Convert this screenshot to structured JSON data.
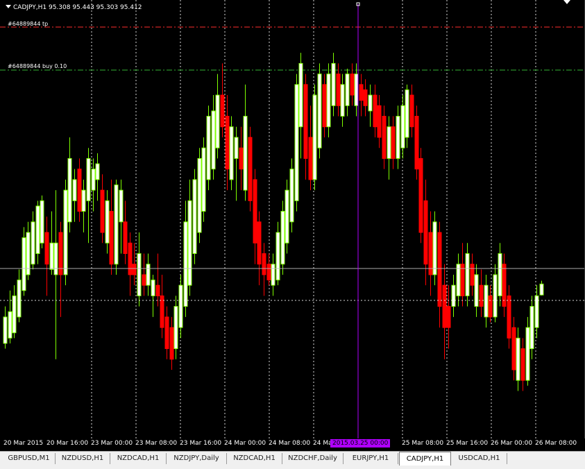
{
  "chart": {
    "title": "CADJPY,H1  95.308 95.443 95.303 95.412",
    "orders": [
      {
        "label": "#64889844 tp",
        "color": "#ff2b2b"
      },
      {
        "label": "#64889844 buy 0.10",
        "color": "#33b233"
      }
    ],
    "time_labels": [
      "20 Mar 2015",
      "20 Mar 16:00",
      "23 Mar 00:00",
      "23 Mar 08:00",
      "23 Mar 16:00",
      "24 Mar 00:00",
      "24 Mar 08:00",
      "24 Mar",
      "25 Mar 08:00",
      "25 Mar 16:00",
      "26 Mar 00:00",
      "26 Mar 08:00"
    ],
    "crosshair_time": "2015.03.25 00:00",
    "colors": {
      "bull_body": "#ffffff",
      "bull_outline": "#7fff00",
      "bear_body": "#ff0000",
      "wick": "#ff0000",
      "background": "#000000",
      "grid": "#ffffff",
      "crosshair": "#b000ff"
    }
  },
  "chart_data": {
    "type": "candlestick",
    "title": "CADJPY,H1",
    "series": [
      {
        "dir": "up",
        "o": 94.85,
        "h": 95.2,
        "l": 94.8,
        "c": 95.1
      },
      {
        "dir": "up",
        "o": 94.9,
        "h": 95.35,
        "l": 94.85,
        "c": 95.15
      },
      {
        "dir": "up",
        "o": 94.95,
        "h": 95.4,
        "l": 94.9,
        "c": 95.3
      },
      {
        "dir": "up",
        "o": 95.1,
        "h": 95.55,
        "l": 95.05,
        "c": 95.45
      },
      {
        "dir": "up",
        "o": 95.35,
        "h": 95.95,
        "l": 95.3,
        "c": 95.85
      },
      {
        "dir": "up",
        "o": 95.5,
        "h": 96.0,
        "l": 95.45,
        "c": 95.9
      },
      {
        "dir": "up",
        "o": 95.6,
        "h": 96.1,
        "l": 95.55,
        "c": 96.0
      },
      {
        "dir": "up",
        "o": 95.7,
        "h": 96.2,
        "l": 95.6,
        "c": 96.15
      },
      {
        "dir": "up",
        "o": 95.8,
        "h": 96.25,
        "l": 95.75,
        "c": 96.2
      },
      {
        "dir": "down",
        "o": 95.9,
        "h": 96.05,
        "l": 95.3,
        "c": 95.6
      },
      {
        "dir": "up",
        "o": 95.55,
        "h": 96.1,
        "l": 95.5,
        "c": 95.8
      },
      {
        "dir": "up",
        "o": 95.5,
        "h": 96.3,
        "l": 94.7,
        "c": 95.8
      },
      {
        "dir": "down",
        "o": 95.9,
        "h": 96.0,
        "l": 95.1,
        "c": 95.5
      },
      {
        "dir": "up",
        "o": 95.5,
        "h": 96.4,
        "l": 95.4,
        "c": 96.3
      },
      {
        "dir": "up",
        "o": 96.0,
        "h": 96.8,
        "l": 95.9,
        "c": 96.6
      },
      {
        "dir": "up",
        "o": 96.2,
        "h": 96.5,
        "l": 96.0,
        "c": 96.4
      },
      {
        "dir": "down",
        "o": 96.5,
        "h": 96.6,
        "l": 96.0,
        "c": 96.1
      },
      {
        "dir": "up",
        "o": 96.1,
        "h": 96.4,
        "l": 95.9,
        "c": 96.3
      },
      {
        "dir": "up",
        "o": 96.2,
        "h": 96.7,
        "l": 95.8,
        "c": 96.6
      },
      {
        "dir": "up",
        "o": 96.3,
        "h": 96.6,
        "l": 96.1,
        "c": 96.5
      },
      {
        "dir": "up",
        "o": 96.4,
        "h": 96.65,
        "l": 96.2,
        "c": 96.55
      },
      {
        "dir": "down",
        "o": 96.3,
        "h": 96.45,
        "l": 95.8,
        "c": 95.9
      },
      {
        "dir": "up",
        "o": 95.8,
        "h": 96.3,
        "l": 95.7,
        "c": 96.2
      },
      {
        "dir": "down",
        "o": 96.1,
        "h": 96.4,
        "l": 95.5,
        "c": 95.6
      },
      {
        "dir": "up",
        "o": 95.6,
        "h": 96.4,
        "l": 95.5,
        "c": 96.35
      },
      {
        "dir": "up",
        "o": 96.0,
        "h": 96.4,
        "l": 95.7,
        "c": 96.3
      },
      {
        "dir": "down",
        "o": 96.0,
        "h": 96.2,
        "l": 95.6,
        "c": 95.7
      },
      {
        "dir": "down",
        "o": 95.8,
        "h": 95.9,
        "l": 95.3,
        "c": 95.5
      },
      {
        "dir": "down",
        "o": 95.6,
        "h": 95.8,
        "l": 95.4,
        "c": 95.5
      },
      {
        "dir": "up",
        "o": 95.3,
        "h": 95.9,
        "l": 95.2,
        "c": 95.7
      },
      {
        "dir": "down",
        "o": 95.5,
        "h": 95.7,
        "l": 95.3,
        "c": 95.4
      },
      {
        "dir": "up",
        "o": 95.4,
        "h": 95.7,
        "l": 95.3,
        "c": 95.6
      },
      {
        "dir": "up",
        "o": 95.3,
        "h": 95.5,
        "l": 95.1,
        "c": 95.45
      },
      {
        "dir": "down",
        "o": 95.4,
        "h": 95.7,
        "l": 95.2,
        "c": 95.3
      },
      {
        "dir": "down",
        "o": 95.3,
        "h": 95.5,
        "l": 94.9,
        "c": 95.0
      },
      {
        "dir": "down",
        "o": 95.1,
        "h": 95.2,
        "l": 94.7,
        "c": 94.8
      },
      {
        "dir": "down",
        "o": 95.0,
        "h": 95.1,
        "l": 94.6,
        "c": 94.7
      },
      {
        "dir": "up",
        "o": 94.8,
        "h": 95.3,
        "l": 94.7,
        "c": 95.2
      },
      {
        "dir": "up",
        "o": 95.0,
        "h": 95.5,
        "l": 94.9,
        "c": 95.4
      },
      {
        "dir": "up",
        "o": 95.2,
        "h": 96.2,
        "l": 95.1,
        "c": 96.0
      },
      {
        "dir": "up",
        "o": 95.4,
        "h": 96.4,
        "l": 95.3,
        "c": 96.2
      },
      {
        "dir": "up",
        "o": 95.7,
        "h": 96.5,
        "l": 95.6,
        "c": 96.4
      },
      {
        "dir": "up",
        "o": 95.9,
        "h": 96.7,
        "l": 95.8,
        "c": 96.6
      },
      {
        "dir": "up",
        "o": 96.1,
        "h": 96.8,
        "l": 96.0,
        "c": 96.7
      },
      {
        "dir": "up",
        "o": 96.4,
        "h": 97.1,
        "l": 96.3,
        "c": 97.0
      },
      {
        "dir": "up",
        "o": 96.5,
        "h": 97.2,
        "l": 96.4,
        "c": 97.05
      },
      {
        "dir": "up",
        "o": 96.7,
        "h": 97.4,
        "l": 96.6,
        "c": 97.2
      },
      {
        "dir": "down",
        "o": 97.2,
        "h": 97.5,
        "l": 96.8,
        "c": 96.9
      },
      {
        "dir": "down",
        "o": 97.0,
        "h": 97.2,
        "l": 96.3,
        "c": 96.5
      },
      {
        "dir": "up",
        "o": 96.4,
        "h": 97.0,
        "l": 96.3,
        "c": 96.9
      },
      {
        "dir": "up",
        "o": 96.6,
        "h": 96.9,
        "l": 96.2,
        "c": 96.8
      },
      {
        "dir": "down",
        "o": 96.7,
        "h": 96.9,
        "l": 96.3,
        "c": 96.5
      },
      {
        "dir": "up",
        "o": 96.3,
        "h": 97.3,
        "l": 96.2,
        "c": 97.0
      },
      {
        "dir": "down",
        "o": 96.8,
        "h": 96.9,
        "l": 96.1,
        "c": 96.2
      },
      {
        "dir": "down",
        "o": 96.4,
        "h": 96.5,
        "l": 95.6,
        "c": 95.8
      },
      {
        "dir": "down",
        "o": 96.0,
        "h": 96.1,
        "l": 95.4,
        "c": 95.6
      },
      {
        "dir": "down",
        "o": 95.7,
        "h": 95.8,
        "l": 95.3,
        "c": 95.5
      },
      {
        "dir": "down",
        "o": 95.6,
        "h": 95.7,
        "l": 95.4,
        "c": 95.45
      },
      {
        "dir": "up",
        "o": 95.4,
        "h": 95.7,
        "l": 95.3,
        "c": 95.6
      },
      {
        "dir": "up",
        "o": 95.45,
        "h": 96.0,
        "l": 95.4,
        "c": 95.9
      },
      {
        "dir": "up",
        "o": 95.6,
        "h": 96.2,
        "l": 95.5,
        "c": 96.1
      },
      {
        "dir": "up",
        "o": 95.8,
        "h": 96.4,
        "l": 95.7,
        "c": 96.3
      },
      {
        "dir": "up",
        "o": 96.0,
        "h": 96.6,
        "l": 95.9,
        "c": 96.5
      },
      {
        "dir": "up",
        "o": 96.2,
        "h": 97.4,
        "l": 96.1,
        "c": 97.3
      },
      {
        "dir": "up",
        "o": 96.9,
        "h": 97.6,
        "l": 96.6,
        "c": 97.5
      },
      {
        "dir": "down",
        "o": 97.3,
        "h": 97.4,
        "l": 96.4,
        "c": 96.6
      },
      {
        "dir": "down",
        "o": 96.8,
        "h": 97.1,
        "l": 96.3,
        "c": 96.4
      },
      {
        "dir": "up",
        "o": 96.4,
        "h": 97.3,
        "l": 96.3,
        "c": 97.2
      },
      {
        "dir": "up",
        "o": 96.7,
        "h": 97.5,
        "l": 96.6,
        "c": 97.4
      },
      {
        "dir": "down",
        "o": 97.3,
        "h": 97.4,
        "l": 96.8,
        "c": 96.9
      },
      {
        "dir": "up",
        "o": 96.9,
        "h": 97.5,
        "l": 96.8,
        "c": 97.4
      },
      {
        "dir": "up",
        "o": 97.1,
        "h": 97.6,
        "l": 97.0,
        "c": 97.5
      },
      {
        "dir": "down",
        "o": 97.4,
        "h": 97.5,
        "l": 97.0,
        "c": 97.1
      },
      {
        "dir": "up",
        "o": 97.0,
        "h": 97.4,
        "l": 96.9,
        "c": 97.3
      },
      {
        "dir": "up",
        "o": 97.1,
        "h": 97.45,
        "l": 97.0,
        "c": 97.4
      },
      {
        "dir": "down",
        "o": 97.4,
        "h": 97.5,
        "l": 97.1,
        "c": 97.2
      },
      {
        "dir": "up",
        "o": 97.1,
        "h": 97.5,
        "l": 97.0,
        "c": 97.4
      },
      {
        "dir": "down",
        "o": 97.3,
        "h": 97.4,
        "l": 97.0,
        "c": 97.15
      },
      {
        "dir": "down",
        "o": 97.25,
        "h": 97.35,
        "l": 97.0,
        "c": 97.1
      },
      {
        "dir": "up",
        "o": 97.05,
        "h": 97.3,
        "l": 96.9,
        "c": 97.2
      },
      {
        "dir": "down",
        "o": 97.2,
        "h": 97.3,
        "l": 96.8,
        "c": 96.9
      },
      {
        "dir": "down",
        "o": 97.1,
        "h": 97.2,
        "l": 96.7,
        "c": 96.8
      },
      {
        "dir": "down",
        "o": 97.0,
        "h": 97.1,
        "l": 96.5,
        "c": 96.6
      },
      {
        "dir": "up",
        "o": 96.6,
        "h": 97.0,
        "l": 96.4,
        "c": 96.9
      },
      {
        "dir": "down",
        "o": 96.9,
        "h": 97.0,
        "l": 96.5,
        "c": 96.6
      },
      {
        "dir": "up",
        "o": 96.6,
        "h": 97.1,
        "l": 96.5,
        "c": 97.0
      },
      {
        "dir": "up",
        "o": 96.7,
        "h": 97.2,
        "l": 96.6,
        "c": 97.1
      },
      {
        "dir": "up",
        "o": 96.8,
        "h": 97.3,
        "l": 96.7,
        "c": 97.25
      },
      {
        "dir": "down",
        "o": 97.2,
        "h": 97.3,
        "l": 96.8,
        "c": 96.9
      },
      {
        "dir": "down",
        "o": 97.0,
        "h": 97.1,
        "l": 96.4,
        "c": 96.5
      },
      {
        "dir": "down",
        "o": 96.6,
        "h": 96.7,
        "l": 95.8,
        "c": 95.9
      },
      {
        "dir": "down",
        "o": 96.2,
        "h": 96.4,
        "l": 95.4,
        "c": 95.6
      },
      {
        "dir": "down",
        "o": 95.9,
        "h": 96.1,
        "l": 95.3,
        "c": 95.5
      },
      {
        "dir": "up",
        "o": 95.5,
        "h": 96.1,
        "l": 95.4,
        "c": 96.0
      },
      {
        "dir": "down",
        "o": 95.9,
        "h": 96.0,
        "l": 95.0,
        "c": 95.2
      },
      {
        "dir": "down",
        "o": 95.4,
        "h": 95.6,
        "l": 94.7,
        "c": 95.0
      },
      {
        "dir": "down",
        "o": 95.2,
        "h": 95.4,
        "l": 94.8,
        "c": 95.0
      },
      {
        "dir": "up",
        "o": 95.2,
        "h": 95.5,
        "l": 95.1,
        "c": 95.4
      },
      {
        "dir": "up",
        "o": 95.3,
        "h": 95.7,
        "l": 95.2,
        "c": 95.6
      },
      {
        "dir": "down",
        "o": 95.6,
        "h": 95.8,
        "l": 95.2,
        "c": 95.3
      },
      {
        "dir": "up",
        "o": 95.3,
        "h": 95.8,
        "l": 95.2,
        "c": 95.7
      },
      {
        "dir": "down",
        "o": 95.6,
        "h": 95.7,
        "l": 95.3,
        "c": 95.4
      },
      {
        "dir": "up",
        "o": 95.2,
        "h": 95.6,
        "l": 95.1,
        "c": 95.5
      },
      {
        "dir": "down",
        "o": 95.4,
        "h": 95.55,
        "l": 95.1,
        "c": 95.2
      },
      {
        "dir": "up",
        "o": 95.1,
        "h": 95.5,
        "l": 95.0,
        "c": 95.4
      },
      {
        "dir": "down",
        "o": 95.3,
        "h": 95.4,
        "l": 95.05,
        "c": 95.1
      },
      {
        "dir": "up",
        "o": 95.1,
        "h": 95.6,
        "l": 95.05,
        "c": 95.5
      },
      {
        "dir": "up",
        "o": 95.3,
        "h": 95.8,
        "l": 95.2,
        "c": 95.7
      },
      {
        "dir": "down",
        "o": 95.6,
        "h": 95.7,
        "l": 95.1,
        "c": 95.2
      },
      {
        "dir": "down",
        "o": 95.3,
        "h": 95.4,
        "l": 94.8,
        "c": 94.9
      },
      {
        "dir": "down",
        "o": 95.0,
        "h": 95.1,
        "l": 94.5,
        "c": 94.6
      },
      {
        "dir": "up",
        "o": 94.5,
        "h": 95.0,
        "l": 94.4,
        "c": 94.9
      },
      {
        "dir": "down",
        "o": 94.8,
        "h": 94.9,
        "l": 94.4,
        "c": 94.5
      },
      {
        "dir": "up",
        "o": 94.5,
        "h": 95.1,
        "l": 94.45,
        "c": 95.0
      },
      {
        "dir": "up",
        "o": 94.8,
        "h": 95.3,
        "l": 94.7,
        "c": 95.2
      },
      {
        "dir": "up",
        "o": 95.0,
        "h": 95.4,
        "l": 94.9,
        "c": 95.3
      },
      {
        "dir": "up",
        "o": 95.308,
        "h": 95.443,
        "l": 95.303,
        "c": 95.412
      }
    ]
  }
}
